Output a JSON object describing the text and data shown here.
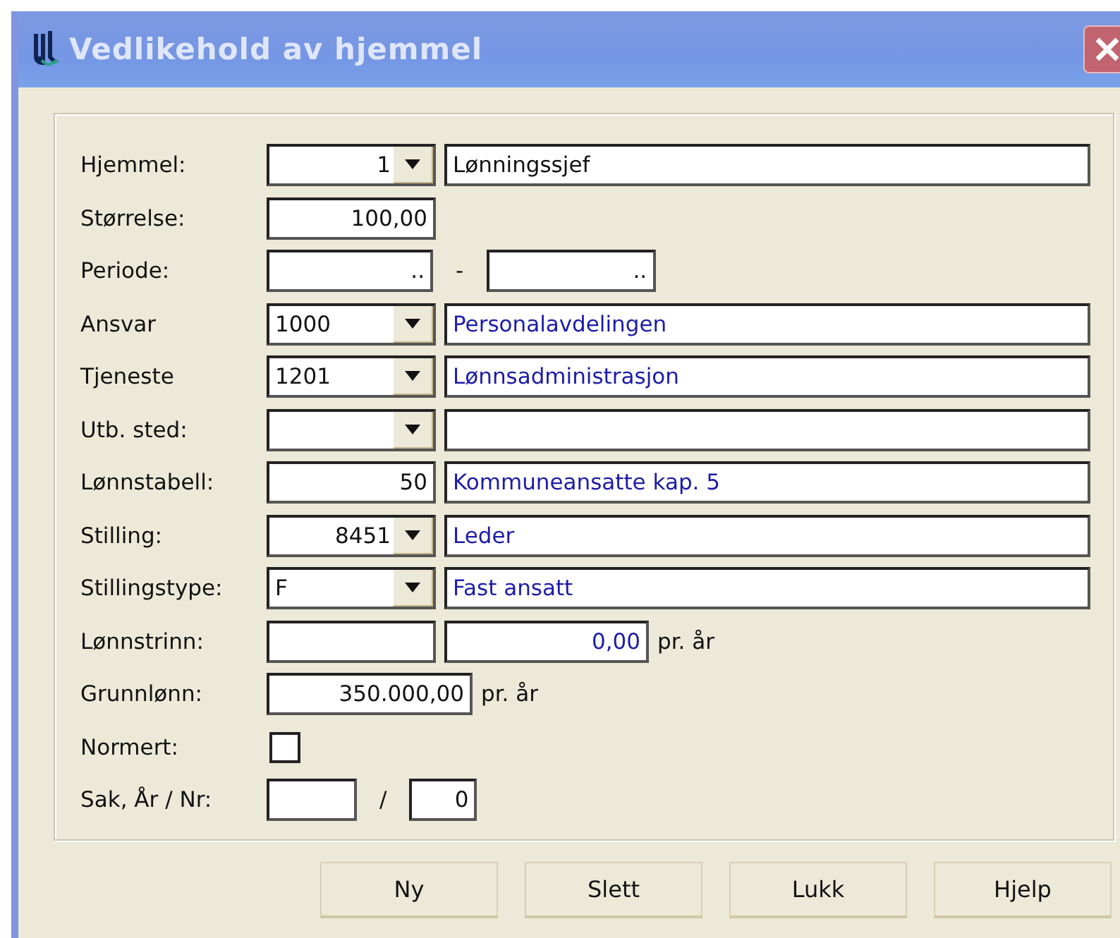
{
  "window": {
    "title": "Vedlikehold av hjemmel"
  },
  "rows": [
    {
      "kind": "lookup",
      "label": "Hjemmel:",
      "code": "1",
      "right_aligned": true,
      "dropdown": true,
      "description": "Lønningssjef",
      "linked": false
    },
    {
      "kind": "amount",
      "label": "Størrelse:",
      "value": "100,00"
    },
    {
      "kind": "period",
      "label": "Periode:",
      "from": "..",
      "separator": "-",
      "to": ".."
    },
    {
      "kind": "lookup",
      "label": "Ansvar",
      "code": "1000",
      "right_aligned": false,
      "dropdown": true,
      "description": "Personalavdelingen",
      "linked": true
    },
    {
      "kind": "lookup",
      "label": "Tjeneste",
      "code": "1201",
      "right_aligned": false,
      "dropdown": true,
      "description": "Lønnsadministrasjon",
      "linked": true
    },
    {
      "kind": "lookup",
      "label": "Utb. sted:",
      "code": "",
      "right_aligned": false,
      "dropdown": true,
      "description": ""
    },
    {
      "kind": "lookup",
      "label": "Lønnstabell:",
      "code": "50",
      "right_aligned": true,
      "dropdown": false,
      "description": "Kommuneansatte kap. 5",
      "linked": true
    },
    {
      "kind": "lookup",
      "label": "Stilling:",
      "code": "8451",
      "right_aligned": true,
      "dropdown": true,
      "description": "Leder",
      "linked": true
    },
    {
      "kind": "lookup",
      "label": "Stillingstype:",
      "code": "F",
      "right_aligned": false,
      "dropdown": true,
      "description": "Fast ansatt",
      "linked": true
    },
    {
      "kind": "rate",
      "label": "Lønnstrinn:",
      "value": "0,00",
      "unit": "pr. år"
    },
    {
      "kind": "salary",
      "label": "Grunnlønn:",
      "value": "350.000,00",
      "unit": "pr. år"
    },
    {
      "kind": "checkbox",
      "label": "Normert:",
      "checked": false
    },
    {
      "kind": "case",
      "label": "Sak, År / Nr:",
      "year": "",
      "separator": "/",
      "number": "0"
    }
  ],
  "buttons": [
    "Ny",
    "Slett",
    "Lukk",
    "Hjelp"
  ]
}
